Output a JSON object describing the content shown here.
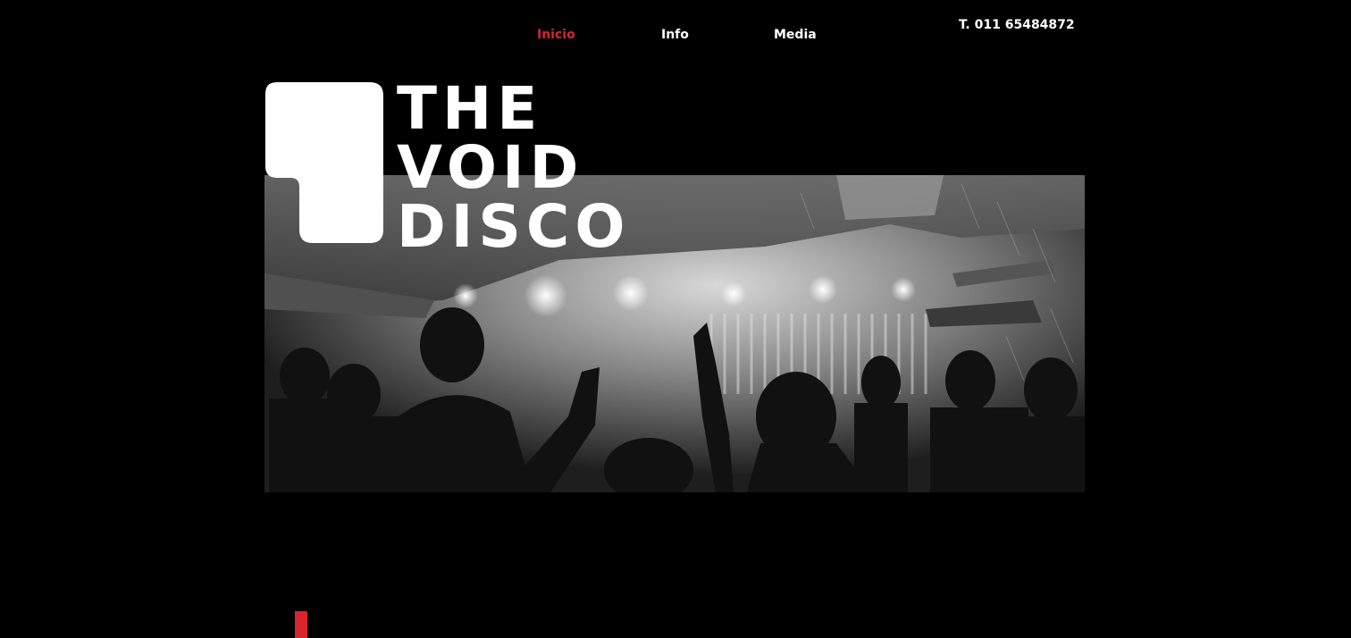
{
  "nav": {
    "items": [
      {
        "label": "Inicio",
        "active": true
      },
      {
        "label": "Info",
        "active": false
      },
      {
        "label": "Media",
        "active": false
      }
    ]
  },
  "header": {
    "phone": "T. 011 65484872"
  },
  "logo": {
    "lines": [
      "THE",
      "VOID",
      "DISCO"
    ]
  },
  "colors": {
    "background": "#000000",
    "accent": "#d8262f",
    "text": "#ffffff"
  }
}
